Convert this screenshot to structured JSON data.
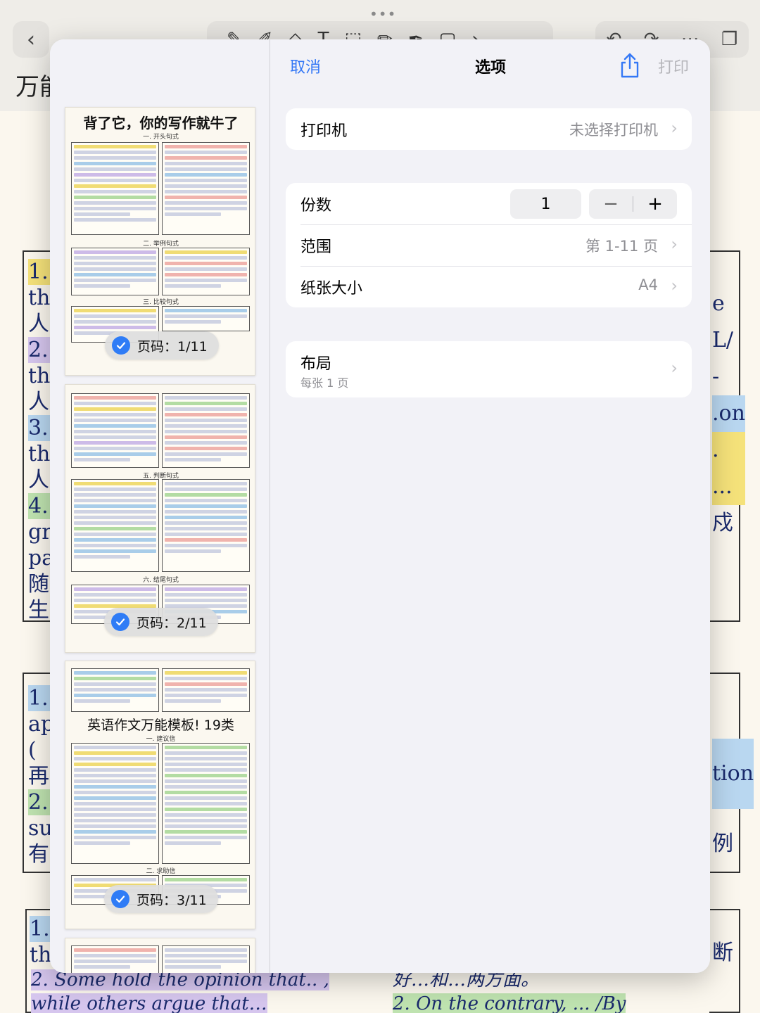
{
  "background_app": {
    "title": "万能",
    "strip_left_1": [
      "1.",
      "the",
      "人",
      "2.",
      "the",
      "人",
      "3.",
      "the",
      "人",
      "4.",
      "gro",
      "par",
      "随",
      "生"
    ],
    "strip_left_2": [
      "1.",
      "ap",
      "(",
      "再",
      "2.",
      "su",
      "有"
    ],
    "strip_left_3": [
      "1.",
      "th"
    ],
    "strip_right_1": [
      "e",
      "L/",
      "-",
      ".on",
      ".",
      "...",
      "戍"
    ],
    "strip_right_2": [
      "tion",
      "例"
    ],
    "strip_right_3": [
      "断"
    ],
    "bottom_left_lines": [
      "2. Some hold the opinion that.. ,",
      "while others argue that…"
    ],
    "bottom_right_lines": [
      "好…和…两方面。",
      "2. On the contrary, ... /By"
    ]
  },
  "header": {
    "cancel_label": "取消",
    "title": "选项",
    "share_icon": "share-icon",
    "print_label": "打印"
  },
  "printer": {
    "label": "打印机",
    "value": "未选择打印机"
  },
  "copies": {
    "label": "份数",
    "value": "1",
    "minus": "−",
    "plus": "+"
  },
  "range": {
    "label": "范围",
    "value": "第 1-11 页"
  },
  "paper_size": {
    "label": "纸张大小",
    "value": "A4"
  },
  "layout": {
    "label": "布局",
    "sub": "每张 1 页"
  },
  "pages": [
    {
      "badge": "页码：1/11",
      "title": "背了它，你的写作就牛了",
      "sections": [
        "一. 开头句式",
        "二. 举例句式",
        "三. 比较句式"
      ]
    },
    {
      "badge": "页码：2/11",
      "sections": [
        "五. 判断句式",
        "六. 结尾句式"
      ]
    },
    {
      "badge": "页码：3/11",
      "title": "英语作文万能模板! 19类",
      "sections": [
        "一. 建议信",
        "二. 求助信"
      ]
    },
    {
      "badge": ""
    }
  ],
  "colors": {
    "accent": "#3478f6",
    "disabled": "#b5b5ba",
    "secondary_text": "#8e8e93",
    "check": "#2f7cf6"
  }
}
